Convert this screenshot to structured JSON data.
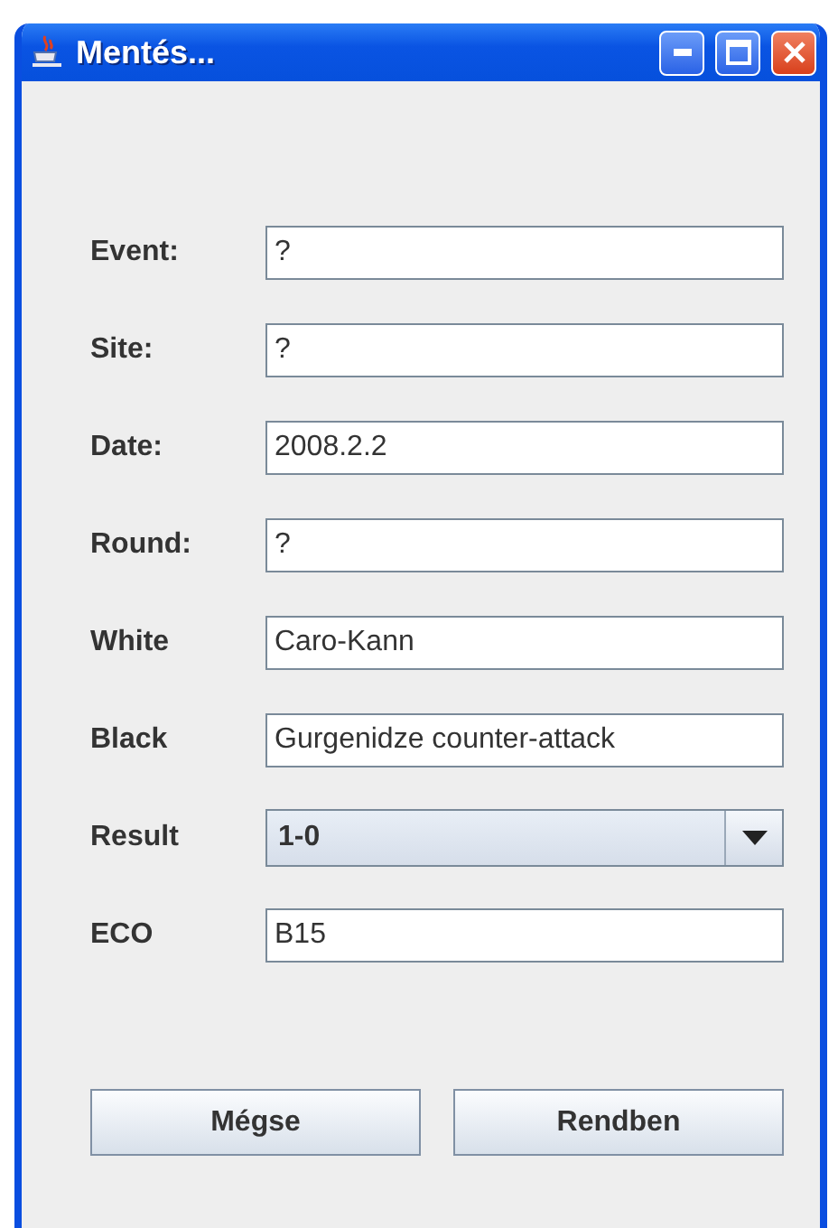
{
  "window": {
    "title": "Mentés..."
  },
  "fields": [
    {
      "label": "Event:",
      "kind": "text",
      "value": "?"
    },
    {
      "label": "Site:",
      "kind": "text",
      "value": "?"
    },
    {
      "label": "Date:",
      "kind": "text",
      "value": "2008.2.2"
    },
    {
      "label": "Round:",
      "kind": "text",
      "value": "?"
    },
    {
      "label": "White",
      "kind": "text",
      "value": "Caro-Kann"
    },
    {
      "label": "Black",
      "kind": "text",
      "value": "Gurgenidze counter-attack"
    },
    {
      "label": "Result",
      "kind": "dropdown",
      "value": "1-0"
    },
    {
      "label": "ECO",
      "kind": "text",
      "value": "B15"
    }
  ],
  "buttons": [
    "Mégse",
    "Rendben"
  ]
}
